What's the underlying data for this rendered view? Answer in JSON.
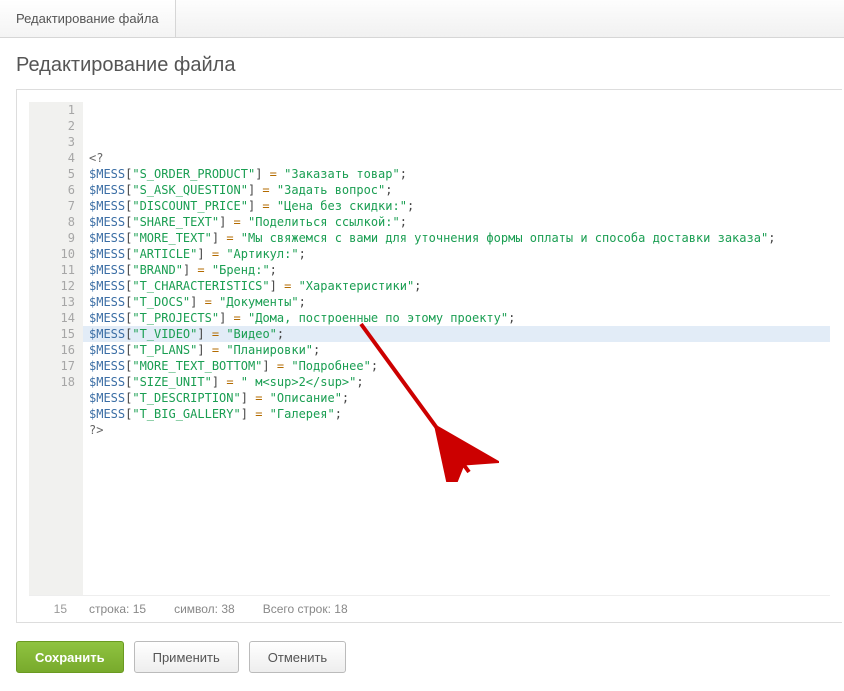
{
  "tab": {
    "label": "Редактирование файла"
  },
  "page_title": "Редактирование файла",
  "editor": {
    "cursor_line": 15,
    "cursor_col": 38,
    "total_lines": 18,
    "status": {
      "line_label": "строка",
      "col_label": "символ",
      "total_label": "Всего строк"
    },
    "highlighted_line": 15,
    "lines": [
      {
        "n": 1,
        "type": "tag",
        "text": "<?"
      },
      {
        "n": 2,
        "type": "stmt",
        "key": "S_ORDER_PRODUCT",
        "val": "Заказать товар"
      },
      {
        "n": 3,
        "type": "stmt",
        "key": "S_ASK_QUESTION",
        "val": "Задать вопрос"
      },
      {
        "n": 4,
        "type": "stmt",
        "key": "DISCOUNT_PRICE",
        "val": "Цена без скидки:"
      },
      {
        "n": 5,
        "type": "stmt",
        "key": "SHARE_TEXT",
        "val": "Поделиться ссылкой:"
      },
      {
        "n": 6,
        "type": "stmt",
        "key": "MORE_TEXT",
        "val": "Мы свяжемся с вами для уточнения формы оплаты и способа доставки заказа"
      },
      {
        "n": 7,
        "type": "stmt",
        "key": "ARTICLE",
        "val": "Артикул:"
      },
      {
        "n": 8,
        "type": "stmt",
        "key": "BRAND",
        "val": "Бренд:"
      },
      {
        "n": 9,
        "type": "stmt",
        "key": "T_CHARACTERISTICS",
        "val": "Характеристики"
      },
      {
        "n": 10,
        "type": "stmt",
        "key": "T_DOCS",
        "val": "Документы"
      },
      {
        "n": 11,
        "type": "stmt",
        "key": "T_PROJECTS",
        "val": "Дома, построенные по этому проекту"
      },
      {
        "n": 12,
        "type": "stmt",
        "key": "T_VIDEO",
        "val": "Видео"
      },
      {
        "n": 13,
        "type": "stmt",
        "key": "T_PLANS",
        "val": "Планировки"
      },
      {
        "n": 14,
        "type": "stmt",
        "key": "MORE_TEXT_BOTTOM",
        "val": "Подробнее"
      },
      {
        "n": 15,
        "type": "stmt",
        "key": "SIZE_UNIT",
        "val": " м<sup>2</sup>"
      },
      {
        "n": 16,
        "type": "stmt",
        "key": "T_DESCRIPTION",
        "val": "Описание"
      },
      {
        "n": 17,
        "type": "stmt",
        "key": "T_BIG_GALLERY",
        "val": "Галерея"
      },
      {
        "n": 18,
        "type": "tag",
        "text": "?>"
      }
    ]
  },
  "buttons": {
    "save": "Сохранить",
    "apply": "Применить",
    "cancel": "Отменить"
  }
}
